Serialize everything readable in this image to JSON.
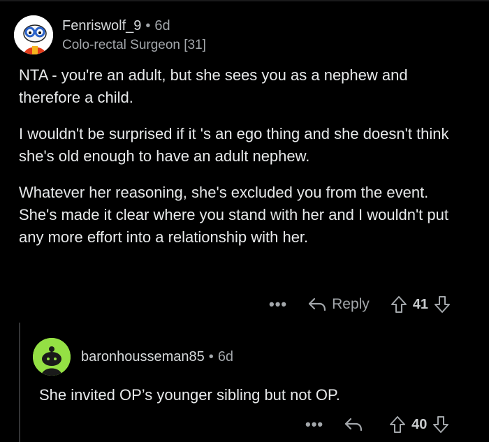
{
  "comment": {
    "username": "Fenriswolf_9",
    "age": "6d",
    "flair": "Colo-rectal Surgeon [31]",
    "paragraphs": [
      "NTA - you're an adult, but she sees you as a nephew and therefore a child.",
      "I wouldn't be surprised if it 's an ego thing and she doesn't think she's old enough to have an adult nephew.",
      "Whatever her reasoning, she's excluded you from the event. She's made it clear where you stand with her and I wouldn't put any more effort into a relationship with her."
    ],
    "reply_label": "Reply",
    "score": "41"
  },
  "reply": {
    "username": "baronhousseman85",
    "age": "6d",
    "text": "She invited OP’s younger sibling but not OP.",
    "score": "40"
  },
  "ui": {
    "separator": "•",
    "more_glyph": "•••",
    "accent_reply_avatar": "#94e044",
    "background": "#000000"
  },
  "icons": [
    "avatar-snoo",
    "more-icon",
    "reply-arrow-icon",
    "upvote-icon",
    "downvote-icon"
  ]
}
